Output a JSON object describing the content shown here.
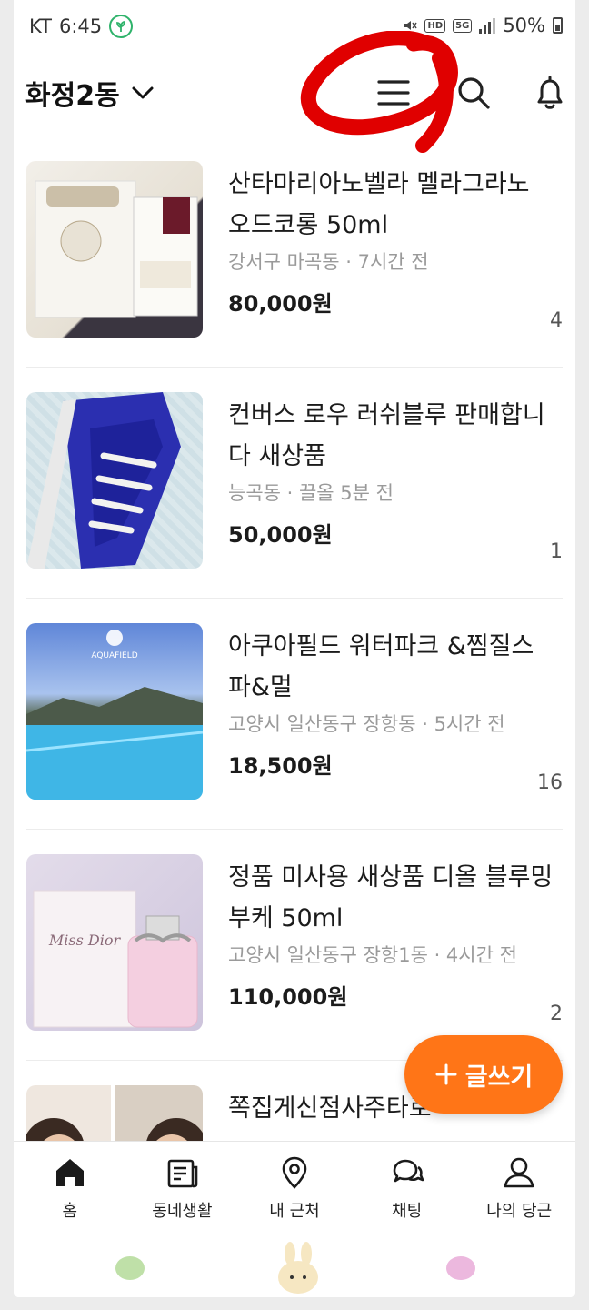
{
  "status_bar": {
    "carrier": "KT",
    "time": "6:45",
    "network_badge_1": "HD",
    "network_badge_2": "5G",
    "battery": "50%"
  },
  "header": {
    "location": "화정2동",
    "icons": [
      "menu-icon",
      "search-icon",
      "bell-icon"
    ]
  },
  "listings": [
    {
      "title": "산타마리아노벨라 멜라그라노 오드코롱 50ml",
      "meta": "강서구 마곡동 · 7시간 전",
      "price": "80,000원",
      "count": "4"
    },
    {
      "title": "컨버스 로우 러쉬블루 판매합니다 새상품",
      "meta": "능곡동 · 끌올 5분 전",
      "price": "50,000원",
      "count": "1"
    },
    {
      "title": "아쿠아필드 워터파크 &찜질스파&멀",
      "meta": "고양시 일산동구 장항동 · 5시간 전",
      "price": "18,500원",
      "count": "16",
      "image_text": "AQUAFIELD"
    },
    {
      "title": "정품 미사용 새상품 디올 블루밍 부케 50ml",
      "meta": "고양시 일산동구 장항1동 · 4시간 전",
      "price": "110,000원",
      "count": "2",
      "image_text": "Miss Dior"
    },
    {
      "title": "쪽집게신점사주타로"
    }
  ],
  "fab": {
    "label": "글쓰기"
  },
  "nav": {
    "tabs": [
      {
        "label": "홈",
        "icon": "home-icon"
      },
      {
        "label": "동네생활",
        "icon": "newspaper-icon"
      },
      {
        "label": "내 근처",
        "icon": "location-pin-icon"
      },
      {
        "label": "채팅",
        "icon": "chat-icon"
      },
      {
        "label": "나의 당근",
        "icon": "person-icon"
      }
    ]
  },
  "colors": {
    "accent": "#ff7517",
    "annotation": "#e00000"
  }
}
